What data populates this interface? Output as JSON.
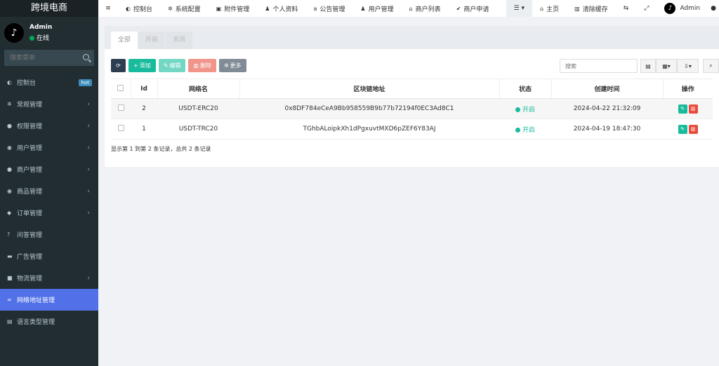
{
  "brand": "跨境电商",
  "user": {
    "name": "Admin",
    "status": "在线",
    "avatar_glyph": "♪"
  },
  "sidebar": {
    "search_placeholder": "搜索菜单",
    "items": [
      {
        "label": "控制台",
        "icon": "dashboard-icon",
        "badge": "hot"
      },
      {
        "label": "常规管理",
        "icon": "cogs-icon"
      },
      {
        "label": "权限管理",
        "icon": "group-icon"
      },
      {
        "label": "用户管理",
        "icon": "user-circle-icon"
      },
      {
        "label": "商户管理",
        "icon": "apple-icon"
      },
      {
        "label": "商品管理",
        "icon": "product-hunt-icon"
      },
      {
        "label": "订单管理",
        "icon": "cube-icon"
      },
      {
        "label": "问答管理",
        "icon": "question-icon"
      },
      {
        "label": "广告管理",
        "icon": "credit-card-icon"
      },
      {
        "label": "物流管理",
        "icon": "truck-icon"
      },
      {
        "label": "网络地址管理",
        "icon": "link-icon",
        "active": true
      },
      {
        "label": "语言类型管理",
        "icon": "language-icon"
      }
    ]
  },
  "topnav": {
    "items": [
      {
        "label": "控制台",
        "icon": "dashboard-icon"
      },
      {
        "label": "系统配置",
        "icon": "cog-icon"
      },
      {
        "label": "附件管理",
        "icon": "image-icon"
      },
      {
        "label": "个人资料",
        "icon": "user-icon"
      },
      {
        "label": "公告管理",
        "icon": "amazon-icon"
      },
      {
        "label": "用户管理",
        "icon": "users-icon"
      },
      {
        "label": "商户列表",
        "icon": "home-icon"
      },
      {
        "label": "商户申请",
        "icon": "check-circle-icon"
      }
    ],
    "home": "主页",
    "clear_cache": "清除缓存",
    "admin": "Admin"
  },
  "tabs": [
    "全部",
    "开启",
    "关闭"
  ],
  "toolbar": {
    "add": "添加",
    "edit": "编辑",
    "delete": "删除",
    "more": "更多",
    "search_placeholder": "搜索"
  },
  "table": {
    "headers": [
      "Id",
      "网络名",
      "区块链地址",
      "状态",
      "创建时间",
      "操作"
    ],
    "rows": [
      {
        "id": "2",
        "name": "USDT-ERC20",
        "address": "0x8DF784eCeA9Bb958559B9b77b72194f0EC3Ad8C1",
        "status": "开启",
        "created": "2024-04-22 21:32:09"
      },
      {
        "id": "1",
        "name": "USDT-TRC20",
        "address": "TGhbALoipkXh1dPgxuvtMXD6pZEF6Y83AJ",
        "status": "开启",
        "created": "2024-04-19 18:47:30"
      }
    ]
  },
  "pager": "显示第 1 到第 2 条记录，总共 2 条记录",
  "colors": {
    "sidebar_bg": "#222d32",
    "active_item": "#5271e8",
    "success": "#18bc9c",
    "danger": "#e74c3c"
  }
}
